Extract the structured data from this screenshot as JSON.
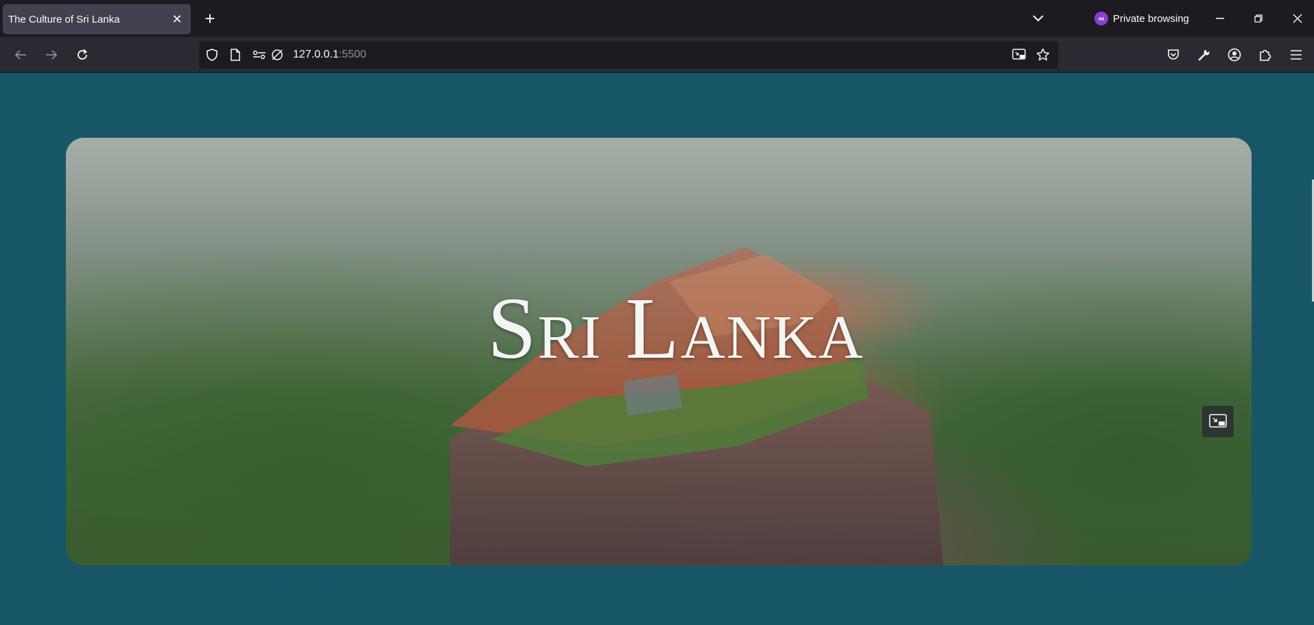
{
  "browser": {
    "tab": {
      "title": "The Culture of Sri Lanka",
      "close_icon": "close-icon"
    },
    "new_tab_icon": "plus-icon",
    "tab_list_icon": "chevron-down-icon",
    "private_label": "Private browsing",
    "window_controls": [
      "minimize-icon",
      "restore-icon",
      "close-icon"
    ],
    "nav": {
      "back_icon": "arrow-left-icon",
      "forward_icon": "arrow-right-icon",
      "reload_icon": "reload-icon"
    },
    "url": {
      "host": "127.0.0.1",
      "port": ":5500"
    },
    "toolbar_icons": [
      "pocket-icon",
      "wrench-icon",
      "account-icon",
      "extensions-icon",
      "menu-icon"
    ]
  },
  "page": {
    "hero_title": "Sri Lanka",
    "pip_icon": "picture-in-picture-icon"
  },
  "colors": {
    "page_background": "#175667",
    "tab_bar": "#1c1b22",
    "nav_bar": "#2b2a33",
    "active_tab": "#42414d",
    "private_accent": "#8a3fd1"
  }
}
